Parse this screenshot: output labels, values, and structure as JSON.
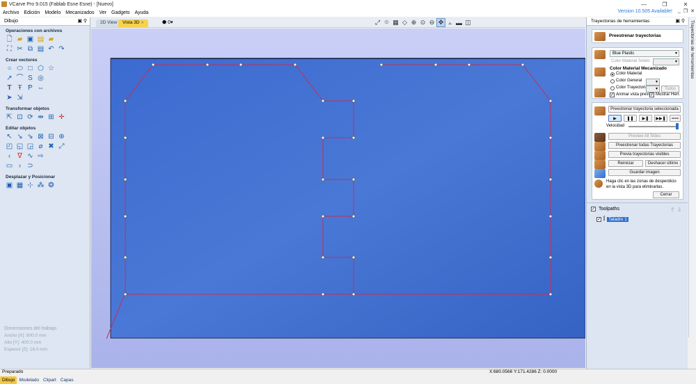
{
  "window": {
    "title": "VCarve Pro 9.015 (Fablab Esne Esne) - [Nuevo]",
    "controls": [
      "—",
      "❐",
      "✕"
    ]
  },
  "menu": {
    "items": [
      "Archivo",
      "Edición",
      "Modelo",
      "Mecanizados",
      "Ver",
      "Gadgets",
      "Ayuda"
    ],
    "version_notice": "Version 10.505 Available!",
    "mdi_controls": [
      "_",
      "❐",
      "✕"
    ]
  },
  "left_panel": {
    "title": "Dibujo",
    "sections": [
      {
        "heading": "Operaciones con archivos",
        "rows": [
          [
            "file-new-icon",
            "folder-open-icon",
            "save-icon",
            "import-icon",
            "folder-icon"
          ],
          [
            "fit-icon",
            "cut-icon",
            "copy-icon",
            "paste-icon",
            "undo-icon",
            "redo-icon"
          ]
        ]
      },
      {
        "heading": "Crear vectores",
        "rows": [
          [
            "circle-icon",
            "ellipse-icon",
            "rectangle-icon",
            "polygon-icon",
            "star-icon"
          ],
          [
            "line-icon",
            "arc-icon",
            "curve-icon",
            "spiral-icon"
          ],
          [
            "text-icon",
            "text-on-curve-icon",
            "text-arc-icon",
            "dimension-icon"
          ],
          [
            "fillet-icon",
            "offset-icon"
          ]
        ]
      },
      {
        "heading": "Transformar objetos",
        "rows": [
          [
            "move-icon",
            "scale-icon",
            "rotate-icon",
            "mirror-icon",
            "size-icon",
            "align-icon"
          ]
        ]
      },
      {
        "heading": "Editar objetos",
        "rows": [
          [
            "select-icon",
            "node-edit-icon",
            "node-add-icon",
            "group-icon",
            "ungroup-icon",
            "weld-icon"
          ],
          [
            "merge-icon",
            "subtract-icon",
            "intersect-icon",
            "join-icon",
            "trim-icon",
            "extend-icon"
          ],
          [
            "smooth-icon",
            "corner-icon",
            "curve-fit-icon",
            "link-icon"
          ],
          [
            "close-icon",
            "split-icon",
            "offset-edit-icon"
          ]
        ]
      },
      {
        "heading": "Desplazar y Posicionar",
        "rows": [
          [
            "layout-icon",
            "nest-icon",
            "array-icon",
            "copy-array-icon",
            "circle-array-icon"
          ]
        ]
      }
    ],
    "job": {
      "heading": "Dimensiones del trabajo",
      "width": "Ancho  [X]: 800.0 mm",
      "height": "Alto   [Y]: 400.0 mm",
      "thickness": "Espesor [Z]: 18.0 mm"
    },
    "bottom_tabs": [
      "Dibujo",
      "Modelado",
      "Clipart",
      "Capas"
    ]
  },
  "view_tabs": {
    "tabs": [
      "2D View",
      "Vista 3D"
    ],
    "active": "Vista 3D",
    "shade_dropdown": "0"
  },
  "viewport": {
    "background_top": "#c9cff7",
    "material_color": "#3f6fd0",
    "toolpath_color": "#c0305a"
  },
  "right_panel": {
    "title": "Trayectorias de herramientas",
    "header_button": "Preestrenar trayectorias",
    "material": {
      "selected": "Blue Plastic",
      "solid_label": "Color Material Sólido",
      "section_heading": "Color Material Mecanizado",
      "options": [
        "Color Material",
        "Color General",
        "Color Trayectoria"
      ],
      "selected_option": "Color Material",
      "all_button": "Todos",
      "animate_label": "Animar vista previa",
      "show_tool_label": "Mostrar Herr."
    },
    "preview": {
      "selected_button": "Preestrenar trayectoria seleccionada",
      "speed_label": "Velocidad",
      "preview_all_sides": "Preview All Sides",
      "preview_all": "Preestrenar todas Trayectorias",
      "preview_visible": "Previa trayectorias visibles",
      "reset": "Reiniciar",
      "undo_last": "Deshacer último",
      "save_image": "Guardar imagen",
      "hint": "Haga clic en las zonas de desperdicio en la vista 3D para eliminarlas.",
      "close": "Cerrar"
    },
    "toolpaths": {
      "heading": "Toolpaths",
      "items": [
        {
          "name": "Taladro 1",
          "checked": true
        }
      ]
    }
  },
  "side_tab": "Trayectorias de herramientas",
  "status": {
    "left": "Preparado",
    "coords": "X:680.0566 Y:171.4286 Z:  0.0000"
  }
}
